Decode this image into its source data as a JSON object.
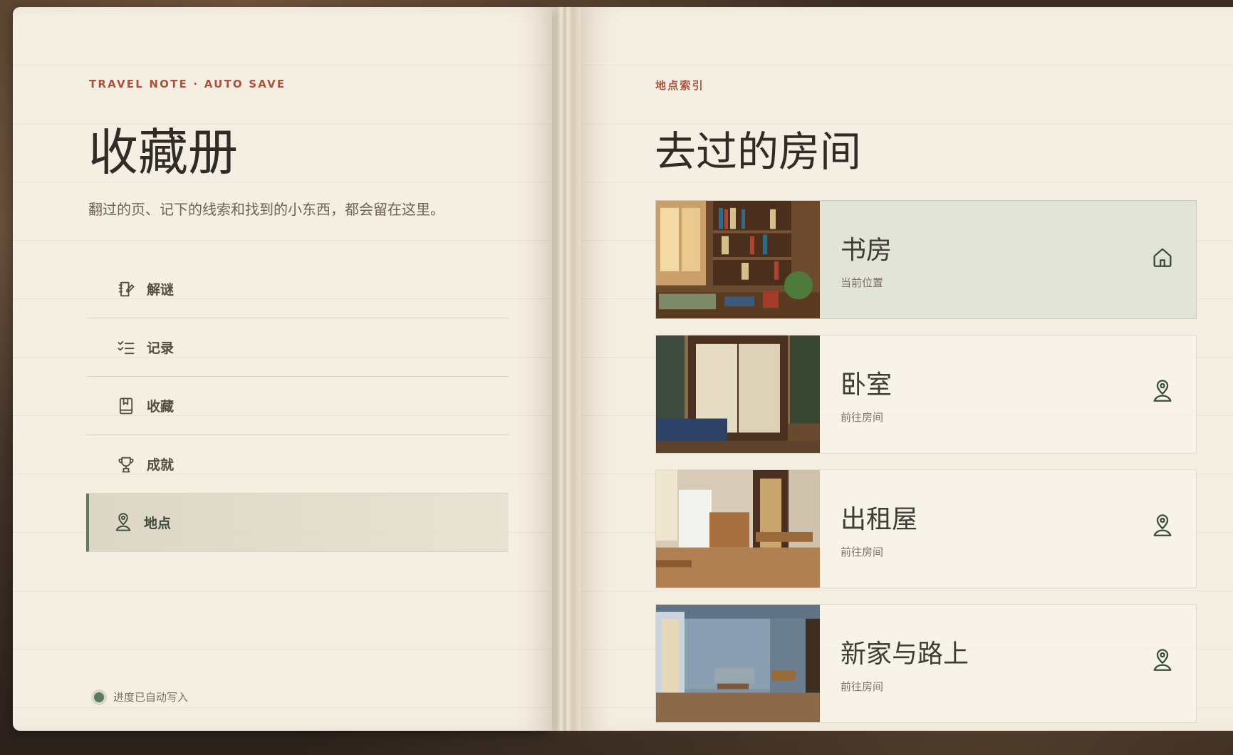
{
  "left_page": {
    "eyebrow": "TRAVEL NOTE · AUTO SAVE",
    "title": "收藏册",
    "intro": "翻过的页、记下的线索和找到的小东西，都会留在这里。",
    "nav": [
      {
        "label": "解谜",
        "icon": "notebook-pencil-icon"
      },
      {
        "label": "记录",
        "icon": "checklist-icon"
      },
      {
        "label": "收藏",
        "icon": "bookmark-book-icon"
      },
      {
        "label": "成就",
        "icon": "trophy-icon"
      },
      {
        "label": "地点",
        "icon": "map-pin-user-icon",
        "active": true
      }
    ],
    "autosave_text": "进度已自动写入"
  },
  "right_page": {
    "eyebrow": "地点索引",
    "title": "去过的房间",
    "rooms": [
      {
        "name": "书房",
        "status": "当前位置",
        "icon": "home-icon",
        "current": true
      },
      {
        "name": "卧室",
        "status": "前往房间",
        "icon": "map-pin-user-icon"
      },
      {
        "name": "出租屋",
        "status": "前往房间",
        "icon": "map-pin-user-icon"
      },
      {
        "name": "新家与路上",
        "status": "前往房间",
        "icon": "map-pin-user-icon"
      }
    ]
  },
  "colors": {
    "accent_red": "#a8533d",
    "accent_green": "#627a61",
    "paper": "#f5eee2",
    "ink": "#2f2b26"
  }
}
